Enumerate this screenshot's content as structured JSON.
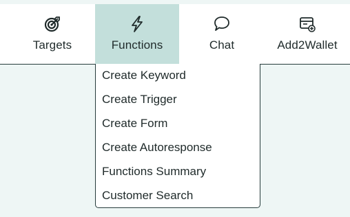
{
  "nav": {
    "items": [
      {
        "label": "Targets",
        "icon": "target-icon"
      },
      {
        "label": "Functions",
        "icon": "lightning-icon",
        "active": true
      },
      {
        "label": "Chat",
        "icon": "chat-bubble-icon"
      },
      {
        "label": "Add2Wallet",
        "icon": "wallet-card-add-icon"
      }
    ]
  },
  "functions_menu": {
    "items": [
      "Create Keyword",
      "Create Trigger",
      "Create Form",
      "Create Autoresponse",
      "Functions Summary",
      "Customer Search"
    ]
  },
  "colors": {
    "active_tab_bg": "#c3dfdb",
    "page_bg": "#eef6f5",
    "text": "#1f2a2a",
    "border": "#253a3a"
  }
}
